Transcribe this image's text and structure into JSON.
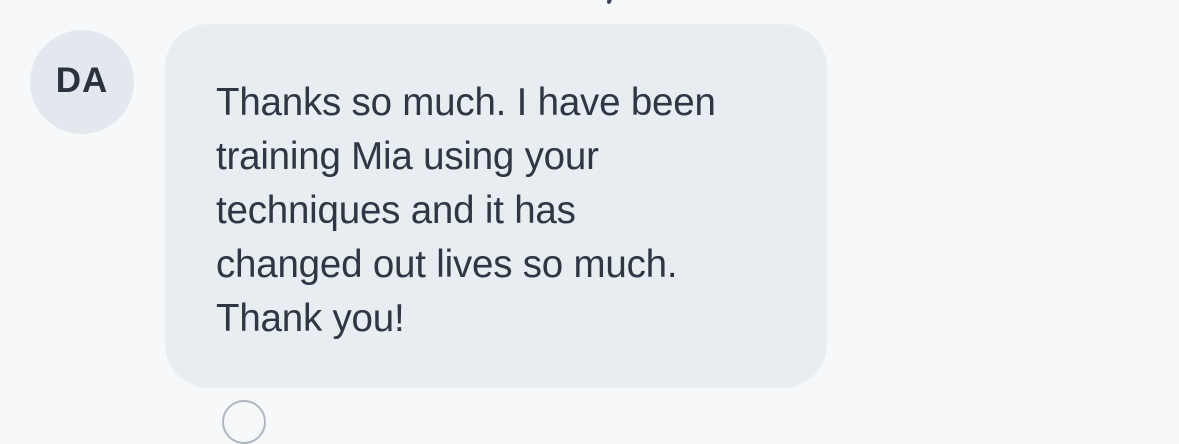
{
  "sender": {
    "initials": "DA"
  },
  "message": {
    "text": "Thanks so much.  I have been\ntraining Mia using your\ntechniques and it has\nchanged out lives so much.\nThank you!"
  },
  "icons": {
    "reaction": "reaction-circle-icon"
  }
}
